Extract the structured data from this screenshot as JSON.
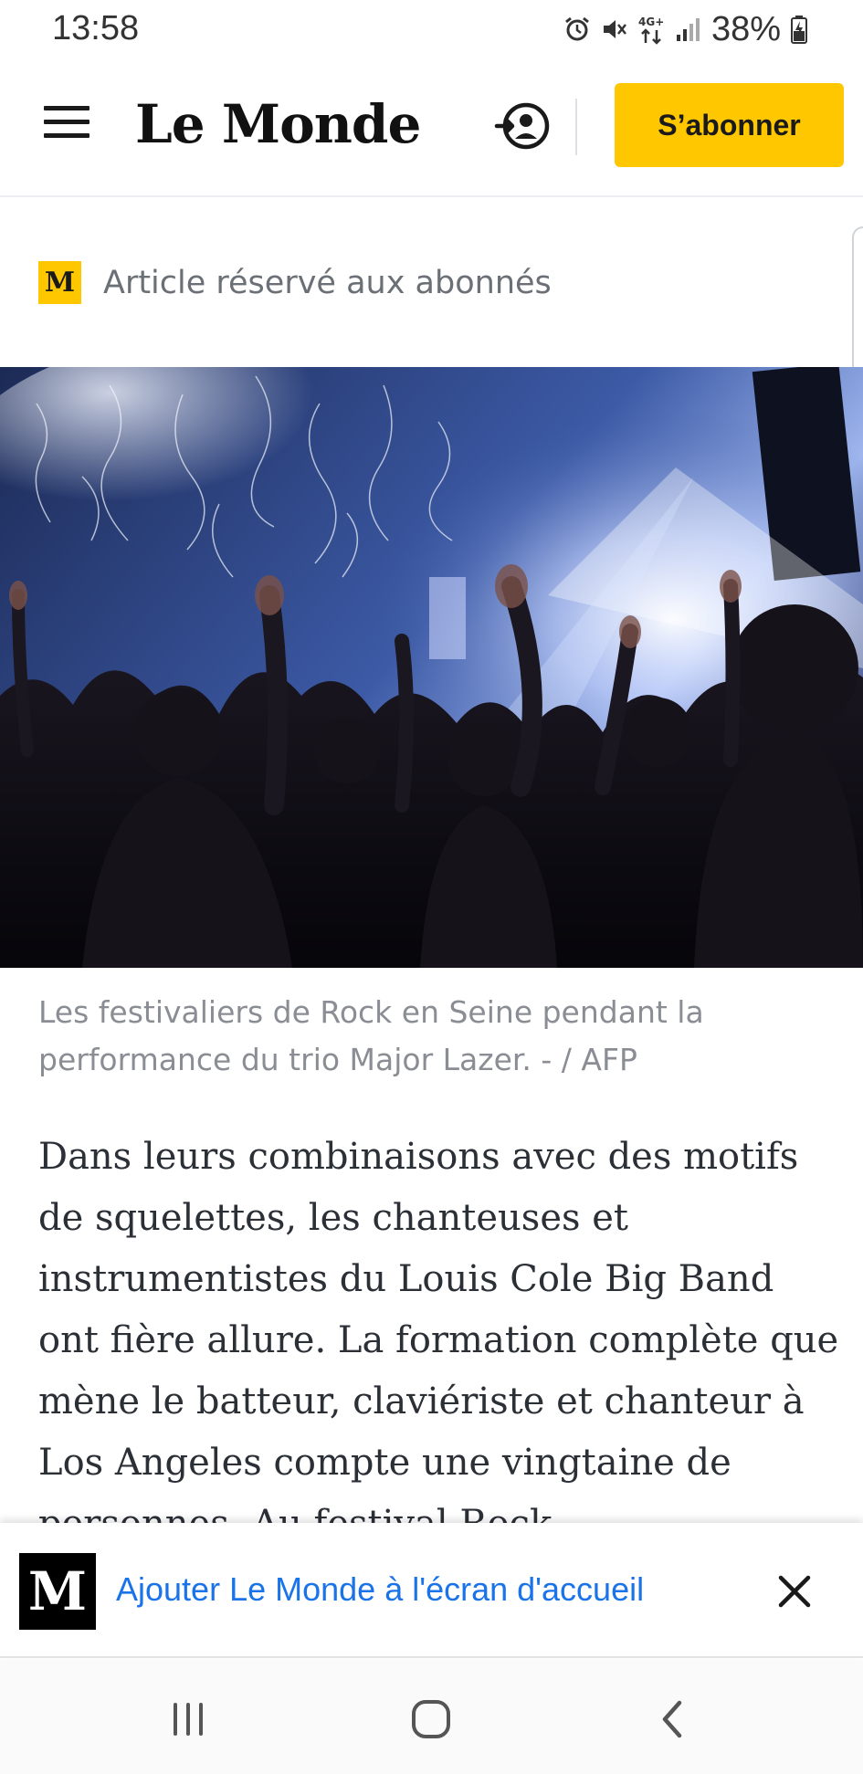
{
  "status_bar": {
    "time": "13:58",
    "network": "4G+",
    "battery": "38%",
    "icons": [
      "alarm-icon",
      "mute-icon",
      "network-4g-icon",
      "signal-icon",
      "battery-icon"
    ]
  },
  "header": {
    "brand": "Le Monde",
    "subscribe_label": "S’abonner",
    "menu_icon": "hamburger-menu-icon",
    "account_icon": "account-login-icon"
  },
  "article": {
    "access_badge": "M",
    "access_label": "Article réservé aux abonnés",
    "image_description_icon": "concert-photo",
    "caption": "Les festivaliers de Rock en Seine pendant la performance du trio Major Lazer. - / AFP",
    "body": "Dans leurs combinaisons avec des motifs de squelettes, les chanteuses et instrumentistes du Louis Cole Big Band ont fière allure. La formation complète que mène le batteur, claviériste et chanteur à Los Angeles compte une vingtaine de personnes. Au festival Rock"
  },
  "install_banner": {
    "logo": "M",
    "text": "Ajouter Le Monde à l'écran d'accueil",
    "close_icon": "close-icon"
  },
  "nav_bar": {
    "buttons": [
      "recent-apps-icon",
      "home-icon",
      "back-icon"
    ]
  },
  "colors": {
    "accent": "#ffc700",
    "link": "#1a73e8",
    "caption": "#8a8e94",
    "body_text": "#2b2f36"
  }
}
